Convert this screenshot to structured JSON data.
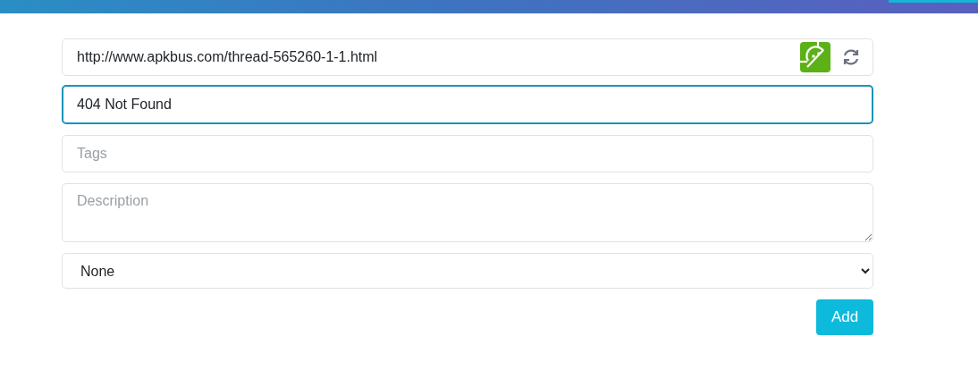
{
  "url_field": {
    "value": "http://www.apkbus.com/thread-565260-1-1.html"
  },
  "title_field": {
    "value": "404 Not Found",
    "focused": true
  },
  "tags_field": {
    "placeholder": "Tags"
  },
  "description_field": {
    "placeholder": "Description"
  },
  "category_select": {
    "value": "None"
  },
  "add_button": {
    "label": "Add"
  }
}
